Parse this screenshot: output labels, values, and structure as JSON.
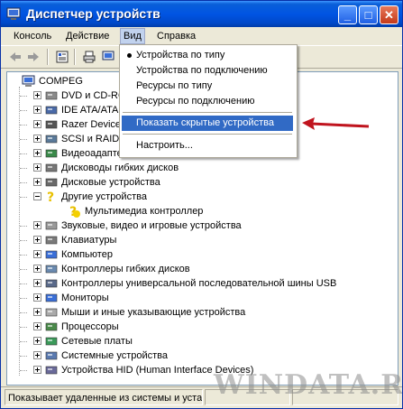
{
  "window": {
    "title": "Диспетчер устройств",
    "min_glyph": "_",
    "max_glyph": "□",
    "close_glyph": "✕"
  },
  "menubar": {
    "items": [
      "Консоль",
      "Действие",
      "Вид",
      "Справка"
    ],
    "active_index": 2
  },
  "toolbar": {
    "buttons": [
      "back-arrow-icon",
      "forward-arrow-icon",
      "properties-icon",
      "print-icon",
      "scan-hardware-icon",
      "update-driver-icon"
    ]
  },
  "view_menu": {
    "items": [
      {
        "label": "Устройства по типу",
        "checked": true
      },
      {
        "label": "Устройства по подключению",
        "checked": false
      },
      {
        "label": "Ресурсы по типу",
        "checked": false
      },
      {
        "label": "Ресурсы по подключению",
        "checked": false
      },
      {
        "label": "Показать скрытые устройства",
        "highlighted": true
      },
      {
        "label": "Настроить..."
      }
    ]
  },
  "tree": {
    "root": "COMPEG",
    "categories": [
      {
        "label": "DVD и CD-RO",
        "icon": "dvd-drive-icon"
      },
      {
        "label": "IDE ATA/ATAI",
        "icon": "ide-controller-icon"
      },
      {
        "label": "Razer Device",
        "icon": "razer-device-icon"
      },
      {
        "label": "SCSI и RAID",
        "icon": "scsi-raid-icon"
      },
      {
        "label": "Видеоадапте",
        "icon": "display-adapter-icon"
      },
      {
        "label": "Дисководы гибких дисков",
        "icon": "floppy-drive-icon"
      },
      {
        "label": "Дисковые устройства",
        "icon": "disk-drive-icon"
      },
      {
        "label": "Другие устройства",
        "icon": "unknown-device-icon",
        "expanded": true,
        "children": [
          {
            "label": "Мультимедиа контроллер",
            "icon": "unknown-device-warning-icon"
          }
        ]
      },
      {
        "label": "Звуковые, видео и игровые устройства",
        "icon": "sound-device-icon"
      },
      {
        "label": "Клавиатуры",
        "icon": "keyboard-icon"
      },
      {
        "label": "Компьютер",
        "icon": "computer-icon"
      },
      {
        "label": "Контроллеры гибких дисков",
        "icon": "floppy-controller-icon"
      },
      {
        "label": "Контроллеры универсальной последовательной шины USB",
        "icon": "usb-controller-icon"
      },
      {
        "label": "Мониторы",
        "icon": "monitor-icon"
      },
      {
        "label": "Мыши и иные указывающие устройства",
        "icon": "mouse-icon"
      },
      {
        "label": "Процессоры",
        "icon": "processor-icon"
      },
      {
        "label": "Сетевые платы",
        "icon": "network-card-icon"
      },
      {
        "label": "Системные устройства",
        "icon": "system-device-icon"
      },
      {
        "label": "Устройства HID (Human Interface Devices)",
        "icon": "hid-device-icon"
      }
    ]
  },
  "statusbar": {
    "text": "Показывает удаленные из системы и уста"
  },
  "watermark": "WINDATA.RU",
  "colors": {
    "title_blue": "#0054e3",
    "highlight": "#316ac5",
    "arrow_red": "#c0141e",
    "window_bg": "#ece9d8"
  }
}
